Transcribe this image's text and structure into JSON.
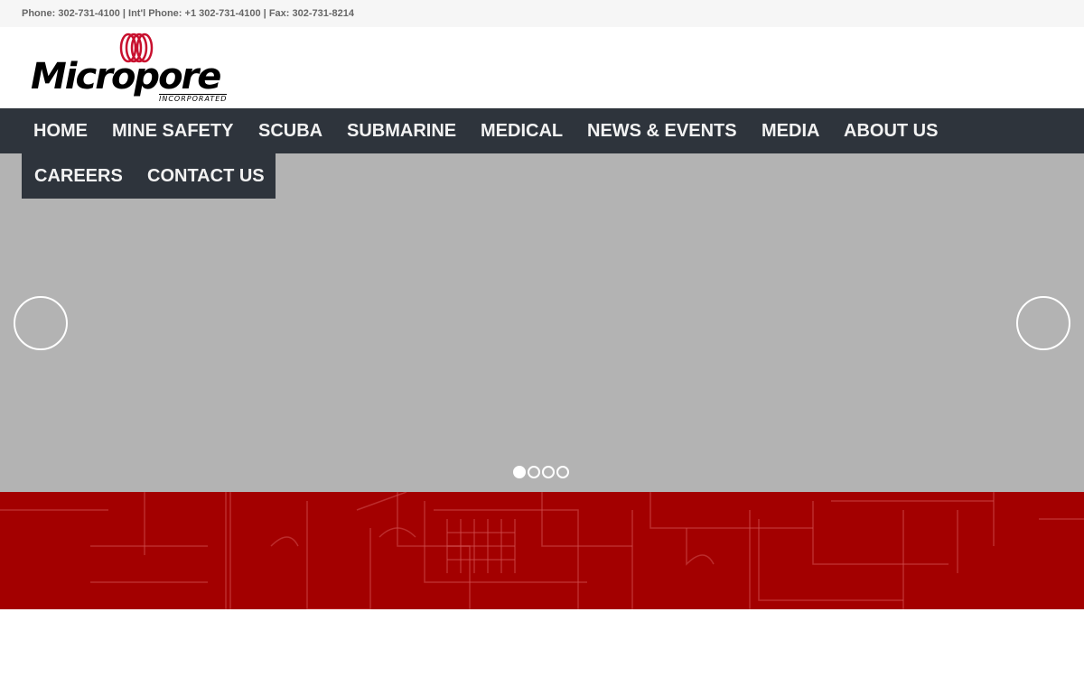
{
  "topbar": {
    "contact_text": "Phone: 302-731-4100 | Int'l Phone: +1 302-731-4100 | Fax: 302-731-8214"
  },
  "logo": {
    "name": "Micropore",
    "subtitle": "INCORPORATED",
    "brand_color": "#c8102e"
  },
  "nav": {
    "items": [
      {
        "label": "HOME"
      },
      {
        "label": "MINE SAFETY"
      },
      {
        "label": "SCUBA"
      },
      {
        "label": "SUBMARINE"
      },
      {
        "label": "MEDICAL"
      },
      {
        "label": "NEWS & EVENTS"
      },
      {
        "label": "MEDIA"
      },
      {
        "label": "ABOUT US"
      },
      {
        "label": "CAREERS"
      },
      {
        "label": "CONTACT US"
      }
    ],
    "background_color": "#2e343c"
  },
  "slider": {
    "background_color": "#b3b3b3",
    "prev_icon": "circle-arrow-left-icon",
    "next_icon": "circle-arrow-right-icon",
    "slide_count": 4,
    "active_slide": 1
  },
  "banner": {
    "background_color": "#a30000",
    "pattern": "blueprint-floorplan"
  }
}
